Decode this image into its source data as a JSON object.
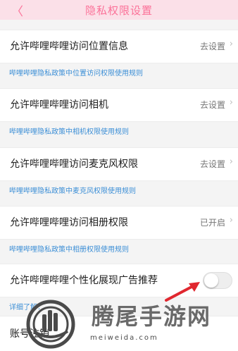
{
  "header": {
    "back_icon": "back-chevron-icon",
    "title": "隐私权限设置"
  },
  "permissions": [
    {
      "label": "允许哔哩哔哩访问位置信息",
      "value": "去设置",
      "rule": "哔哩哔哩隐私政策中位置访问权限使用规则"
    },
    {
      "label": "允许哔哩哔哩访问相机",
      "value": "去设置",
      "rule": "哔哩哔哩隐私政策中相机权限使用规则"
    },
    {
      "label": "允许哔哩哔哩访问麦克风权限",
      "value": "去设置",
      "rule": "哔哩哔哩隐私政策中麦克风权限使用规则"
    },
    {
      "label": "允许哔哩哔哩访问相册权限",
      "value": "已开启",
      "rule": "哔哩哔哩隐私政策中相册权限使用规则"
    }
  ],
  "ad_personalization": {
    "label": "允许哔哩哔哩个性化展现广告推荐",
    "enabled": false,
    "more_info": "详细了解："
  },
  "account": {
    "label": "账号注销"
  },
  "watermark": {
    "text": "腾尾手游网",
    "url": "meiweida.com"
  },
  "colors": {
    "accent": "#fb7299",
    "link": "#3d8fd6",
    "arrow": "#e0272f"
  }
}
